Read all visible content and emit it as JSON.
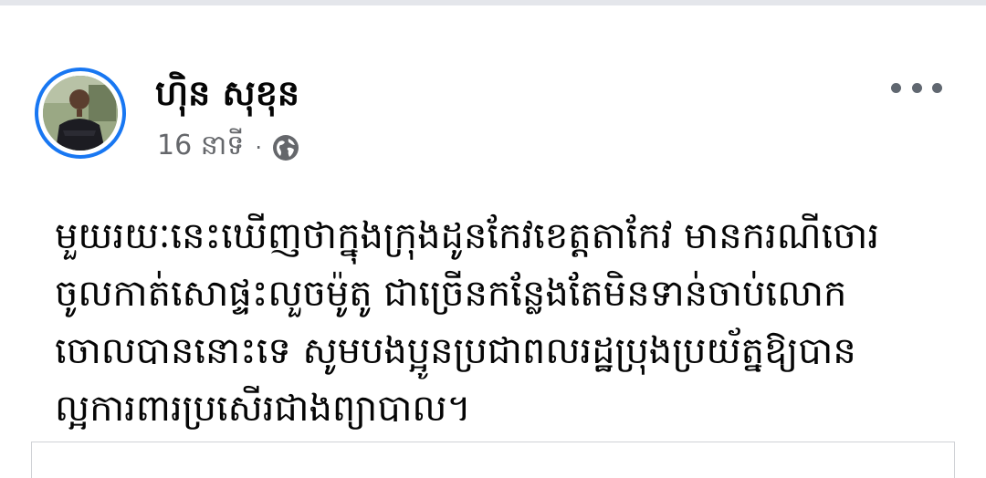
{
  "post": {
    "author": {
      "name": "ហ៊ិន សុខុន",
      "avatar_icon": "profile-photo"
    },
    "meta": {
      "time": "16 នាទី",
      "separator": "·",
      "privacy_icon": "globe-icon"
    },
    "menu_icon": "more-options-icon",
    "text": "មួយរយៈនេះឃើញថាក្នុងក្រុងដូនកែវខេត្តតាកែវ មានករណីចោរ\nចូលកាត់សោផ្ទះលួចម៉ូតូ ជាច្រើនកន្លែងតែមិនទាន់ចាប់លោក\nចោលបាននោះទេ សូមបងប្អូនប្រជាពលរដ្ឋប្រុងប្រយ័ត្នឱ្យបាន\nល្អការពារប្រសើរជាងព្យាបាល។"
  },
  "colors": {
    "accent": "#1877f2",
    "secondary_text": "#65676b",
    "primary_text": "#050505"
  }
}
